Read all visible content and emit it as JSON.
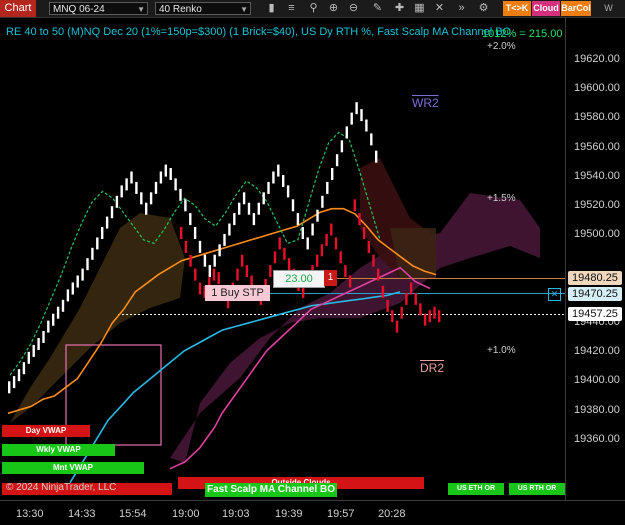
{
  "toolbar": {
    "chart_label": "Chart",
    "symbol": "MNQ 06-24",
    "bar_type": "40 Renko",
    "tk_label": "T<>K",
    "cloud_label": "Cloud",
    "barcol_label": "BarCol",
    "view_label": "W VIEW"
  },
  "chart_title": "RE 40 to 50 (M)NQ Dec 20 (1%=150p=$300) (1 Brick=$40), US Dy RTH %, Fast Scalp MA Channel BO",
  "top_right_value": "1012% = 215.00",
  "pct_labels": {
    "plus2": "+2.0%",
    "plus15": "+1.5%",
    "plus1": "+1.0%"
  },
  "wr2_label": "WR2",
  "dr2_label": "DR2",
  "order": {
    "price_box": "23.00",
    "qty": "1",
    "buy_stp": "1 Buy STP"
  },
  "y_axis": {
    "ticks": [
      "19620.00",
      "19600.00",
      "19580.00",
      "19560.00",
      "19540.00",
      "19520.00",
      "19500.00",
      "19440.00",
      "19420.00",
      "19400.00",
      "19380.00",
      "19360.00"
    ],
    "price_boxes": [
      "19480.25",
      "19470.25",
      "19457.25"
    ]
  },
  "x_axis": {
    "ticks": [
      "13:30",
      "14:33",
      "15:54",
      "19:00",
      "19:03",
      "19:39",
      "19:57",
      "20:28"
    ]
  },
  "bottom_labels": {
    "day_vwap": "Day VWAP",
    "wkly_vwap": "Wkly VWAP",
    "mnt_vwap": "Mnt VWAP",
    "outside_clouds": "Outside Clouds",
    "fast_scalp": "Fast Scalp MA Channel BO",
    "us_eth_or": "US ETH OR",
    "us_rth_or": "US RTH OR",
    "copyright": "© 2024 NinjaTrader, LLC"
  },
  "chart_data": {
    "type": "line",
    "chart_subtype": "renko",
    "y_range": [
      19350,
      19628
    ],
    "series": [
      {
        "name": "",
        "color": "#ffffff",
        "values": [
          19415,
          19418,
          19422,
          19426,
          19432,
          19436,
          19440,
          19444,
          19450,
          19454,
          19458,
          19462,
          19468,
          19472,
          19476,
          19480,
          19486,
          19492,
          19498,
          19504,
          19510,
          19516,
          19522,
          19528,
          19532,
          19536,
          19530,
          19524,
          19518,
          19524,
          19530,
          19536,
          19540,
          19538,
          19532,
          19526,
          19520,
          19512,
          19504,
          19496,
          19488,
          19482,
          19488,
          19494,
          19500,
          19506,
          19512,
          19518,
          19524,
          19518,
          19512,
          19518,
          19524,
          19530,
          19536,
          19540,
          19534,
          19528,
          19520,
          19512,
          19504,
          19498,
          19506,
          19514,
          19522,
          19530,
          19538,
          19546,
          19554,
          19562,
          19570,
          19576,
          19572,
          19566,
          19558,
          19548
        ]
      },
      {
        "name": "",
        "color": "#e8102a",
        "values": [
          19504,
          19496,
          19488,
          19480,
          19472,
          19470,
          19475,
          19480,
          19478,
          19470,
          19464,
          19472,
          19480,
          19488,
          19482,
          19476,
          19470,
          19466,
          19474,
          19482,
          19490,
          19498,
          19492,
          19486,
          19480,
          19474,
          19470,
          19476,
          19482,
          19488,
          19494,
          19500,
          19506,
          19498,
          19490,
          19482,
          19476,
          19520,
          19512,
          19504,
          19496,
          19488,
          19480,
          19470,
          19462,
          19456,
          19450,
          19458,
          19466,
          19472,
          19466,
          19460,
          19454,
          19456,
          19458,
          19456
        ]
      },
      {
        "name": "",
        "color": "#ff8c1a",
        "values": [
          19400,
          19402,
          19404,
          19408,
          19410,
          19415,
          19420,
          19430,
          19440,
          19452,
          19460,
          19470,
          19475,
          19480,
          19484,
          19488,
          19490,
          19492,
          19494,
          19496,
          19498,
          19500,
          19502,
          19504,
          19506,
          19508,
          19512,
          19516,
          19518,
          19518,
          19515,
          19508,
          19500,
          19495,
          19490,
          19485,
          19482,
          19480
        ]
      },
      {
        "name": "",
        "color": "#29b9e6",
        "values": [
          19360,
          19372,
          19384,
          19396,
          19404,
          19412,
          19418,
          19424,
          19430,
          19436,
          19440,
          19444,
          19448,
          19450,
          19452,
          19454,
          19456,
          19458,
          19460,
          19462,
          19463,
          19464,
          19465,
          19466,
          19467,
          19468,
          19470
        ]
      },
      {
        "name": "",
        "color": "#e040a0",
        "values": [
          19368,
          19370,
          19372,
          19376,
          19380,
          19386,
          19392,
          19400,
          19406,
          19412,
          19418,
          19424,
          19430,
          19436,
          19440,
          19444,
          19448,
          19452,
          19456,
          19460,
          19462,
          19464,
          19466,
          19468,
          19470,
          19472,
          19474,
          19476,
          19478,
          19480,
          19482,
          19484,
          19480,
          19476,
          19474,
          19472
        ]
      },
      {
        "name": "",
        "color": "#22c55e",
        "values": [
          19422,
          19430,
          19440,
          19452,
          19466,
          19480,
          19496,
          19510,
          19522,
          19528,
          19524,
          19516,
          19508,
          19500,
          19498,
          19506,
          19516,
          19524,
          19520,
          19512,
          19508,
          19516,
          19526,
          19534,
          19530,
          19522,
          19510,
          19498,
          19500,
          19520,
          19540,
          19556,
          19562,
          19558,
          19540,
          19520,
          19500
        ]
      }
    ]
  },
  "colors": {
    "background": "#000000",
    "title": "#16c2d6",
    "up_brick": "#ffffff",
    "down_brick": "#e8102a",
    "vwap": "#29b9e6",
    "channel": "#ff8c1a",
    "lower_band": "#e040a0",
    "ma": "#22c55e",
    "purple_cloud": "#5a1a4a",
    "label_red": "#d41414",
    "label_green": "#17c617"
  },
  "icons": [
    "dropdown-icon",
    "search-icon",
    "zoom-in-icon",
    "zoom-out-icon",
    "bar-chart-icon",
    "properties-icon",
    "drawing-icon",
    "crosshair-icon",
    "grid-icon",
    "forward-icon",
    "close-icon"
  ]
}
